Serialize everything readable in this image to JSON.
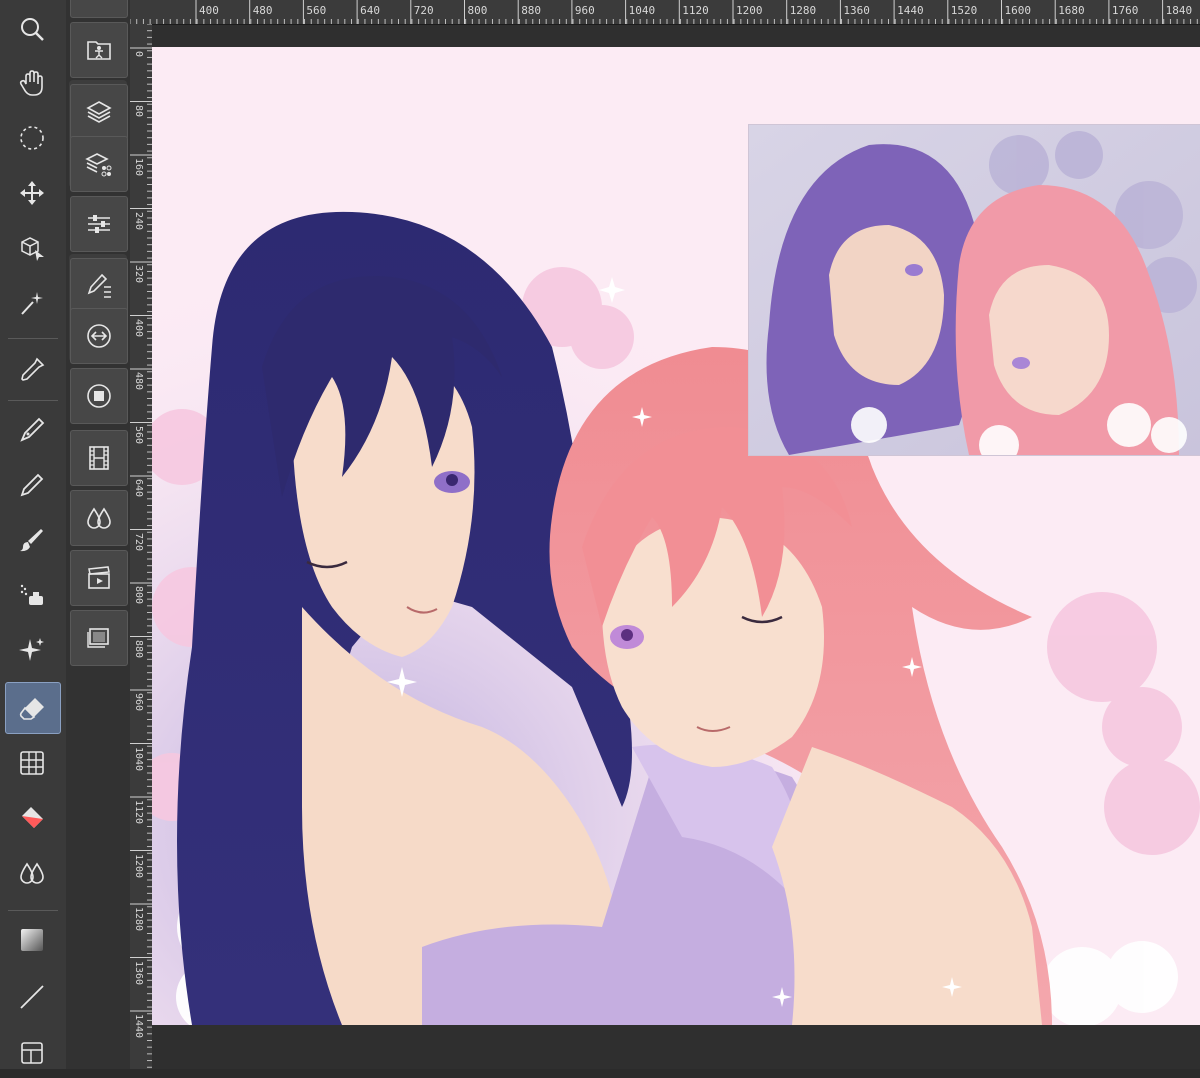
{
  "ruler": {
    "horizontal": [
      "400",
      "480",
      "560",
      "640",
      "720",
      "800",
      "880",
      "960",
      "1040",
      "1120",
      "1200",
      "1280",
      "1360",
      "1440",
      "1520",
      "1600",
      "1680",
      "1760",
      "1840"
    ],
    "vertical": [
      "0",
      "80",
      "160",
      "240",
      "320",
      "400",
      "480",
      "560",
      "640",
      "720",
      "800",
      "880",
      "960",
      "1040",
      "1120",
      "1200",
      "1280",
      "1360",
      "1440"
    ]
  },
  "toolbar": {
    "tools": [
      {
        "name": "zoom-tool",
        "icon": "magnifier-icon"
      },
      {
        "name": "hand-tool",
        "icon": "hand-icon"
      },
      {
        "name": "selection-tool",
        "icon": "dotted-circle-icon"
      },
      {
        "name": "move-tool",
        "icon": "move-arrows-icon"
      },
      {
        "name": "object-tool",
        "icon": "cube-pointer-icon"
      },
      {
        "name": "auto-select-tool",
        "icon": "magic-wand-icon"
      },
      {
        "name": "eyedropper-tool",
        "icon": "eyedropper-icon"
      },
      {
        "name": "pen-tool",
        "icon": "pen-nib-icon"
      },
      {
        "name": "pencil-tool",
        "icon": "pencil-icon"
      },
      {
        "name": "brush-tool",
        "icon": "brush-icon"
      },
      {
        "name": "airbrush-tool",
        "icon": "airbrush-icon"
      },
      {
        "name": "decoration-tool",
        "icon": "sparkle-icon"
      },
      {
        "name": "eraser-tool",
        "icon": "eraser-icon"
      },
      {
        "name": "grid-tool",
        "icon": "grid-icon"
      },
      {
        "name": "fill-tool",
        "icon": "bucket-icon"
      },
      {
        "name": "blend-tool",
        "icon": "drops-icon"
      },
      {
        "name": "gradient-tool",
        "icon": "gradient-icon"
      },
      {
        "name": "line-tool",
        "icon": "line-icon"
      },
      {
        "name": "frame-tool",
        "icon": "frame-icon"
      }
    ],
    "active_tool": "eraser-tool"
  },
  "palette": {
    "buttons": [
      {
        "name": "material-button",
        "icon": "folder-person-icon"
      },
      {
        "name": "layer-button",
        "icon": "layers-icon"
      },
      {
        "name": "layer-property-button",
        "icon": "layers-effect-icon"
      },
      {
        "name": "tool-property-button",
        "icon": "sliders-icon"
      },
      {
        "name": "sub-tool-button",
        "icon": "pen-list-icon"
      },
      {
        "name": "navigator-button",
        "icon": "navigator-icon"
      },
      {
        "name": "color-button",
        "icon": "color-square-icon"
      },
      {
        "name": "animation-button",
        "icon": "film-icon"
      },
      {
        "name": "color-mix-button",
        "icon": "drops-icon"
      },
      {
        "name": "timeline-button",
        "icon": "clapper-icon"
      },
      {
        "name": "window-button",
        "icon": "windows-icon"
      }
    ]
  },
  "colors": {
    "accent": "#5b6e8c",
    "canvas_bg": "#fcebf4",
    "toolbar_bg": "#3a3a3a",
    "hair_dark": "#2e2a6e",
    "hair_pink": "#ef9aa0"
  },
  "canvas": {
    "content": "anime-illustration"
  }
}
